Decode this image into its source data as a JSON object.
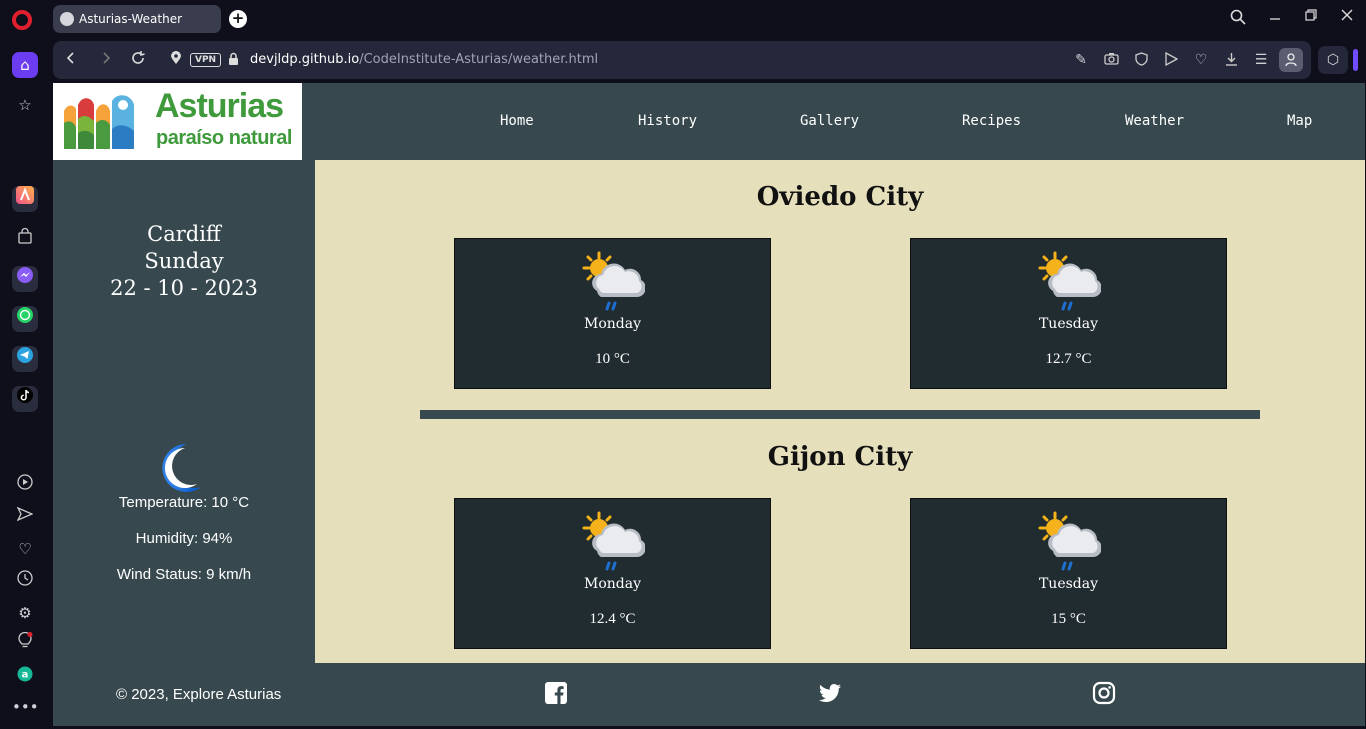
{
  "browser": {
    "tab_title": "Asturias-Weather",
    "vpn_label": "VPN",
    "url_host": "devjldp.github.io",
    "url_path": "/CodeInstitute-Asturias/weather.html"
  },
  "site": {
    "logo": {
      "line1": "Asturias",
      "line2": "paraíso natural"
    },
    "nav": [
      "Home",
      "History",
      "Gallery",
      "Recipes",
      "Weather",
      "Map"
    ],
    "current": {
      "city": "Cardiff",
      "day": "Sunday",
      "date": "22 - 10 - 2023",
      "icon": "moon-icon",
      "temperature": "Temperature: 10 °C",
      "humidity": "Humidity: 94%",
      "wind": "Wind Status: 9 km/h"
    },
    "forecasts": [
      {
        "city": "Oviedo City",
        "days": [
          {
            "day": "Monday",
            "temp": "10 °C",
            "icon": "sun-cloud-rain-icon"
          },
          {
            "day": "Tuesday",
            "temp": "12.7 °C",
            "icon": "sun-cloud-rain-icon"
          }
        ]
      },
      {
        "city": "Gijon City",
        "days": [
          {
            "day": "Monday",
            "temp": "12.4 °C",
            "icon": "sun-cloud-rain-icon"
          },
          {
            "day": "Tuesday",
            "temp": "15 °C",
            "icon": "sun-cloud-rain-icon"
          }
        ]
      }
    ],
    "footer": {
      "copyright": "© 2023, Explore Asturias",
      "social": [
        "facebook-icon",
        "twitter-icon",
        "instagram-icon"
      ]
    },
    "colors": {
      "header_bg": "#37494f",
      "main_bg": "#e5dfbb",
      "card_bg": "#212c30",
      "logo_green": "#3f9a3b"
    }
  }
}
